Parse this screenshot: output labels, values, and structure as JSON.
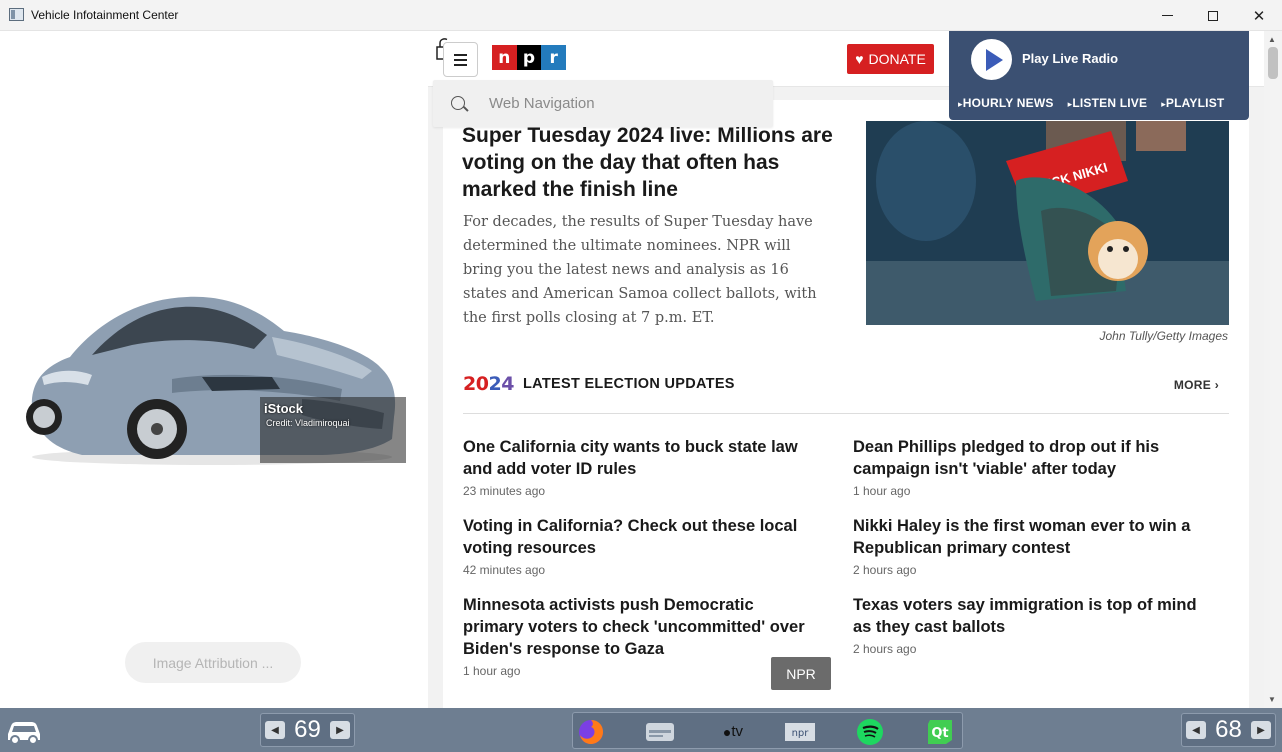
{
  "window": {
    "title": "Vehicle Infotainment Center"
  },
  "left_panel": {
    "image_watermark": "iStock",
    "image_credit": "Credit: Vladimiroquai",
    "attribution_button": "Image Attribution ..."
  },
  "browser": {
    "logo": [
      "n",
      "p",
      "r"
    ],
    "donate_label": "DONATE",
    "radio": {
      "title": "Play Live Radio",
      "links": [
        "HOURLY NEWS",
        "LISTEN LIVE",
        "PLAYLIST"
      ]
    },
    "search": {
      "placeholder": "Web Navigation"
    },
    "lead": {
      "headline": "Super Tuesday 2024 live: Millions are voting on the day that often has marked the finish line",
      "teaser": "For decades, the results of Super Tuesday have determined the ultimate nominees. NPR will bring you the latest news and analysis as 16 states and American Samoa collect ballots, with the first polls closing at 7 p.m. ET.",
      "image_credit": "John Tully/Getty Images",
      "image_sign": "PICK NIKKI"
    },
    "section": {
      "year_parts": [
        "20",
        "2",
        "4"
      ],
      "title": "LATEST ELECTION UPDATES",
      "more": "MORE ›"
    },
    "stories": [
      {
        "title": "One California city wants to buck state law and add voter ID rules",
        "time": "23 minutes ago"
      },
      {
        "title": "Dean Phillips pledged to drop out if his campaign isn't 'viable' after today",
        "time": "1 hour ago"
      },
      {
        "title": "Voting in California? Check out these local voting resources",
        "time": "42 minutes ago"
      },
      {
        "title": "Nikki Haley is the first woman ever to win a Republican primary contest",
        "time": "2 hours ago"
      },
      {
        "title": "Minnesota activists push Democratic primary voters to check 'uncommitted' over Biden's response to Gaza",
        "time": "1 hour ago"
      },
      {
        "title": "Texas voters say immigration is top of mind as they cast ballots",
        "time": "2 hours ago"
      }
    ],
    "source_tag": "NPR"
  },
  "dock": {
    "temp_left": "69",
    "temp_right": "68",
    "apps": [
      "firefox-icon",
      "radio-icon",
      "apple-tv-icon",
      "npr-icon",
      "spotify-icon",
      "qt-icon"
    ],
    "appletv_label": "tv",
    "npr_label": "npr",
    "qt_label": "Qt"
  }
}
